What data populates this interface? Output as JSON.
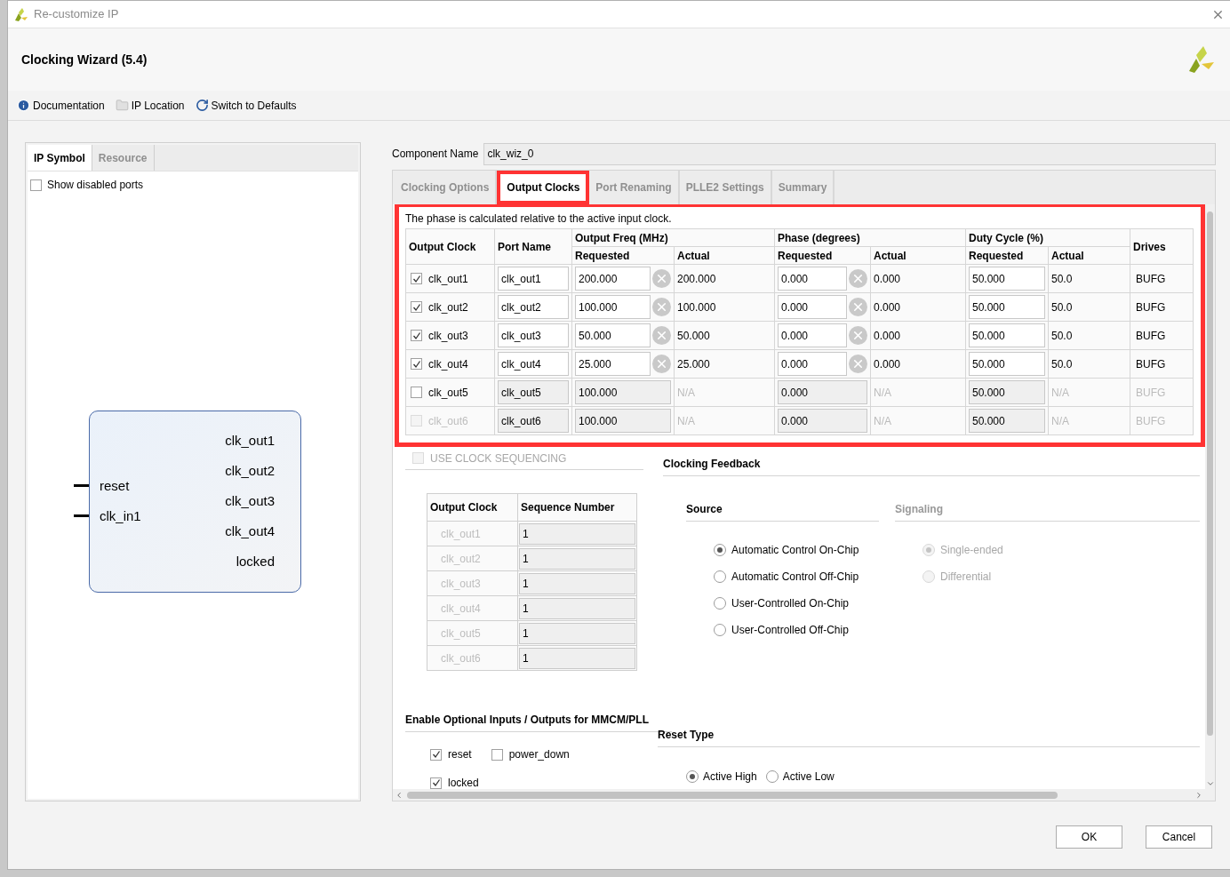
{
  "window": {
    "title": "Re-customize IP"
  },
  "header": {
    "title": "Clocking Wizard (5.4)"
  },
  "toolbar": [
    {
      "label": "Documentation",
      "kind": "info"
    },
    {
      "label": "IP Location",
      "kind": "folder"
    },
    {
      "label": "Switch to Defaults",
      "kind": "refresh"
    }
  ],
  "left_tabs": [
    {
      "label": "IP Symbol",
      "selected": true
    },
    {
      "label": "Resource",
      "selected": false
    }
  ],
  "show_disabled_ports": {
    "label": "Show disabled ports",
    "checked": false
  },
  "symbol": {
    "inputs": [
      "reset",
      "clk_in1"
    ],
    "outputs": [
      "clk_out1",
      "clk_out2",
      "clk_out3",
      "clk_out4",
      "locked"
    ]
  },
  "component_name": {
    "label": "Component Name",
    "value": "clk_wiz_0"
  },
  "tabs": [
    {
      "label": "Clocking Options",
      "selected": false,
      "highlighted": false
    },
    {
      "label": "Output Clocks",
      "selected": true,
      "highlighted": true
    },
    {
      "label": "Port Renaming",
      "selected": false,
      "highlighted": false
    },
    {
      "label": "PLLE2 Settings",
      "selected": false,
      "highlighted": false
    },
    {
      "label": "Summary",
      "selected": false,
      "highlighted": false
    }
  ],
  "output_clocks": {
    "highlighted": true,
    "note": "The phase is calculated relative to the active input clock.",
    "columns": {
      "clock": "Output Clock",
      "port": "Port Name",
      "freq": "Output Freq (MHz)",
      "phase": "Phase (degrees)",
      "duty": "Duty Cycle (%)",
      "drives": "Drives",
      "requested": [
        "Requested",
        "Requested",
        "Requested"
      ],
      "actual": [
        "Actual",
        "Actual",
        "Actual"
      ]
    },
    "rows": [
      {
        "checked": true,
        "disabled": false,
        "clock": "clk_out1",
        "port": "clk_out1",
        "freq_requested": "200.000",
        "freq_actual": "200.000",
        "phase_requested": "0.000",
        "phase_actual": "0.000",
        "duty_requested": "50.000",
        "duty_actual": "50.0",
        "drives": "BUFG"
      },
      {
        "checked": true,
        "disabled": false,
        "clock": "clk_out2",
        "port": "clk_out2",
        "freq_requested": "100.000",
        "freq_actual": "100.000",
        "phase_requested": "0.000",
        "phase_actual": "0.000",
        "duty_requested": "50.000",
        "duty_actual": "50.0",
        "drives": "BUFG"
      },
      {
        "checked": true,
        "disabled": false,
        "clock": "clk_out3",
        "port": "clk_out3",
        "freq_requested": "50.000",
        "freq_actual": "50.000",
        "phase_requested": "0.000",
        "phase_actual": "0.000",
        "duty_requested": "50.000",
        "duty_actual": "50.0",
        "drives": "BUFG"
      },
      {
        "checked": true,
        "disabled": false,
        "clock": "clk_out4",
        "port": "clk_out4",
        "freq_requested": "25.000",
        "freq_actual": "25.000",
        "phase_requested": "0.000",
        "phase_actual": "0.000",
        "duty_requested": "50.000",
        "duty_actual": "50.0",
        "drives": "BUFG"
      },
      {
        "checked": false,
        "disabled": false,
        "clock": "clk_out5",
        "port": "clk_out5",
        "freq_requested": "100.000",
        "freq_actual": "N/A",
        "phase_requested": "0.000",
        "phase_actual": "N/A",
        "duty_requested": "50.000",
        "duty_actual": "N/A",
        "drives": "BUFG"
      },
      {
        "checked": false,
        "disabled": true,
        "clock": "clk_out6",
        "port": "clk_out6",
        "freq_requested": "100.000",
        "freq_actual": "N/A",
        "phase_requested": "0.000",
        "phase_actual": "N/A",
        "duty_requested": "50.000",
        "duty_actual": "N/A",
        "drives": "BUFG"
      }
    ]
  },
  "clock_sequencing": {
    "label": "USE CLOCK SEQUENCING",
    "checked": false,
    "disabled": true,
    "columns": [
      "Output Clock",
      "Sequence Number"
    ],
    "rows": [
      {
        "clock": "clk_out1",
        "sequence": "1"
      },
      {
        "clock": "clk_out2",
        "sequence": "1"
      },
      {
        "clock": "clk_out3",
        "sequence": "1"
      },
      {
        "clock": "clk_out4",
        "sequence": "1"
      },
      {
        "clock": "clk_out5",
        "sequence": "1"
      },
      {
        "clock": "clk_out6",
        "sequence": "1"
      }
    ]
  },
  "clocking_feedback": {
    "title": "Clocking Feedback",
    "source": {
      "title": "Source",
      "disabled": false,
      "options": [
        {
          "label": "Automatic Control On-Chip",
          "selected": true
        },
        {
          "label": "Automatic Control Off-Chip",
          "selected": false
        },
        {
          "label": "User-Controlled On-Chip",
          "selected": false
        },
        {
          "label": "User-Controlled Off-Chip",
          "selected": false
        }
      ]
    },
    "signaling": {
      "title": "Signaling",
      "disabled": true,
      "options": [
        {
          "label": "Single-ended",
          "selected": true
        },
        {
          "label": "Differential",
          "selected": false
        }
      ]
    }
  },
  "optional_io": {
    "title": "Enable Optional Inputs / Outputs for MMCM/PLL",
    "items": [
      {
        "label": "reset",
        "checked": true
      },
      {
        "label": "power_down",
        "checked": false
      },
      {
        "label": "locked",
        "checked": true
      }
    ]
  },
  "reset_type": {
    "title": "Reset Type",
    "options": [
      {
        "label": "Active High",
        "selected": true
      },
      {
        "label": "Active Low",
        "selected": false
      }
    ]
  },
  "buttons": [
    "OK",
    "Cancel"
  ]
}
